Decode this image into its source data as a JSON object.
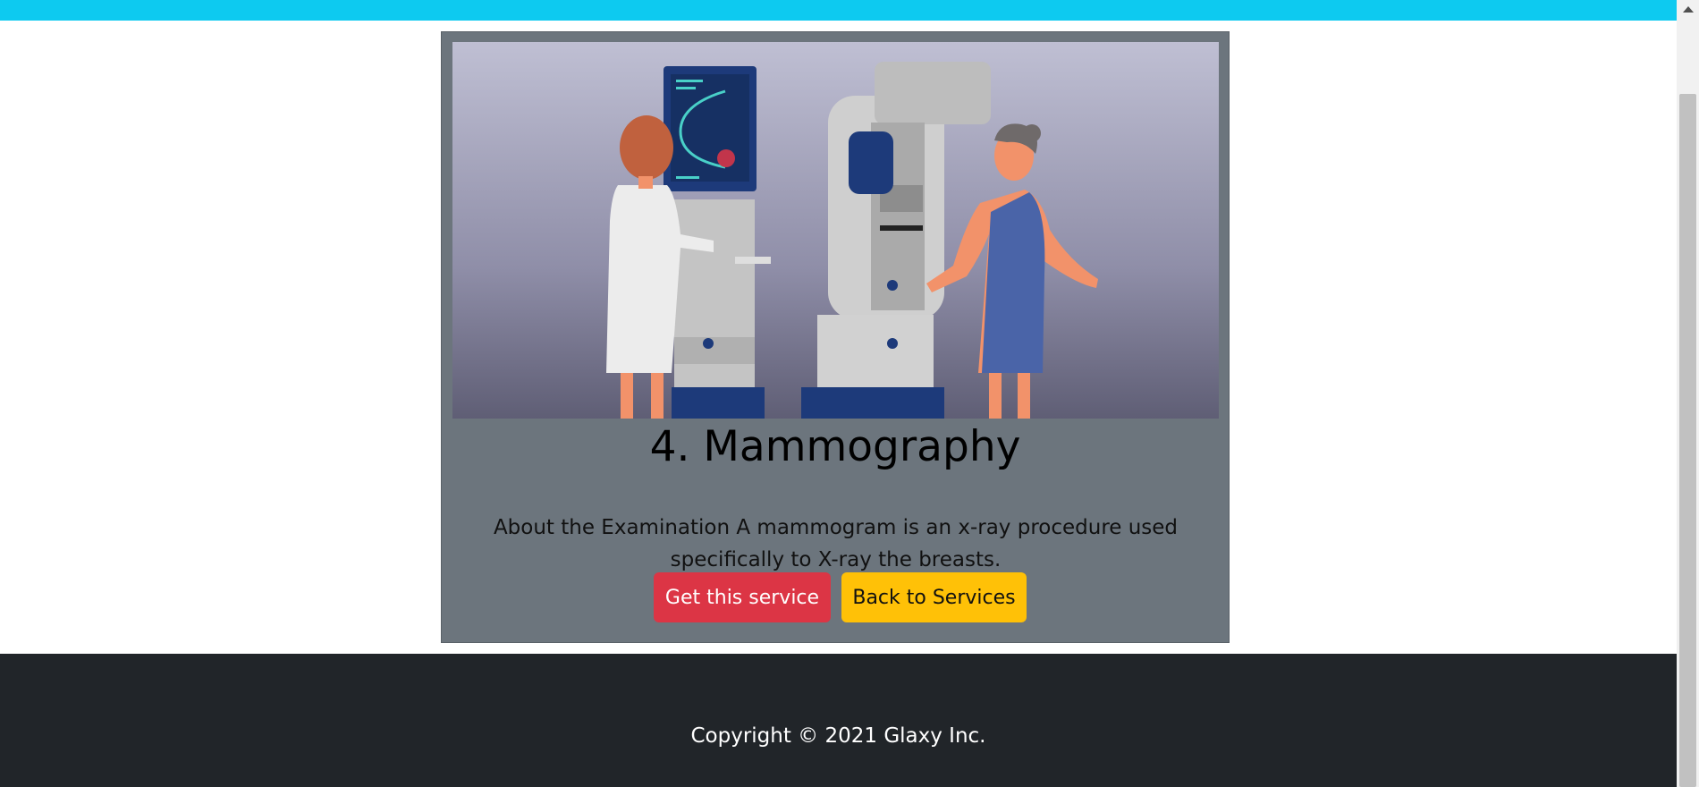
{
  "colors": {
    "topbar": "#0dcaf0",
    "card_bg": "#6c757d",
    "primary_button": "#dc3545",
    "secondary_button": "#ffc107",
    "footer_bg": "#212529"
  },
  "service": {
    "title": "4. Mammography",
    "description": "About the Examination A mammogram is an x-ray procedure used specifically to X-ray the breasts.",
    "image_icon": "mammography-illustration"
  },
  "buttons": {
    "get_service": "Get this service",
    "back_to_services": "Back to Services"
  },
  "footer": {
    "copyright": "Copyright © 2021 Glaxy Inc."
  },
  "scrollbar": {
    "up_icon": "chevron-up-icon"
  }
}
